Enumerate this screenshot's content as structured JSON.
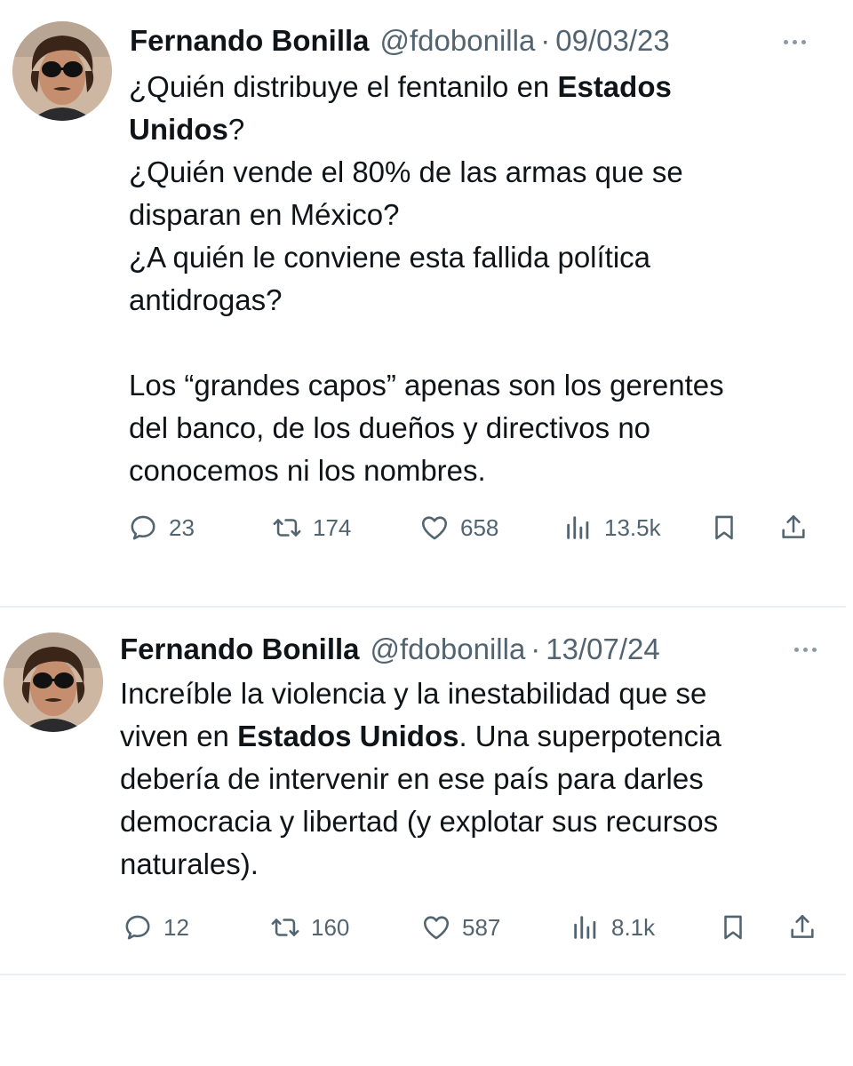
{
  "tweets": [
    {
      "author": "Fernando Bonilla",
      "handle": "@fdobonilla",
      "separator": "·",
      "date": "09/03/23",
      "lines": {
        "l1_pre": "¿Quién distribuye el fentanilo en ",
        "l1_bold": "Estados",
        "l2_bold": "Unidos",
        "l2_post": "?",
        "l3": "¿Quién vende el 80% de las armas que se",
        "l4": "disparan en México?",
        "l5": "¿A quién le conviene esta fallida política",
        "l6": "antidrogas?",
        "l7": "Los “grandes capos” apenas son los gerentes",
        "l8": "del banco, de los dueños y directivos no",
        "l9": "conocemos ni los nombres."
      },
      "stats": {
        "replies": "23",
        "retweets": "174",
        "likes": "658",
        "views": "13.5k"
      }
    },
    {
      "author": "Fernando Bonilla",
      "handle": "@fdobonilla",
      "separator": "·",
      "date": "13/07/24",
      "lines": {
        "l1": "Increíble la violencia y la inestabilidad que se",
        "l2_pre": "viven en ",
        "l2_bold": "Estados Unidos",
        "l2_post": ". Una superpotencia",
        "l3": "debería de intervenir en ese país para darles",
        "l4": "democracia y libertad (y explotar sus recursos",
        "l5": "naturales)."
      },
      "stats": {
        "replies": "12",
        "retweets": "160",
        "likes": "587",
        "views": "8.1k"
      }
    }
  ],
  "icons": {
    "reply": "reply-icon",
    "retweet": "retweet-icon",
    "like": "heart-icon",
    "views": "views-icon",
    "bookmark": "bookmark-icon",
    "share": "share-icon",
    "more": "more-icon"
  },
  "colors": {
    "text": "#0f1419",
    "secondary": "#536471",
    "divider": "#eceff1"
  }
}
